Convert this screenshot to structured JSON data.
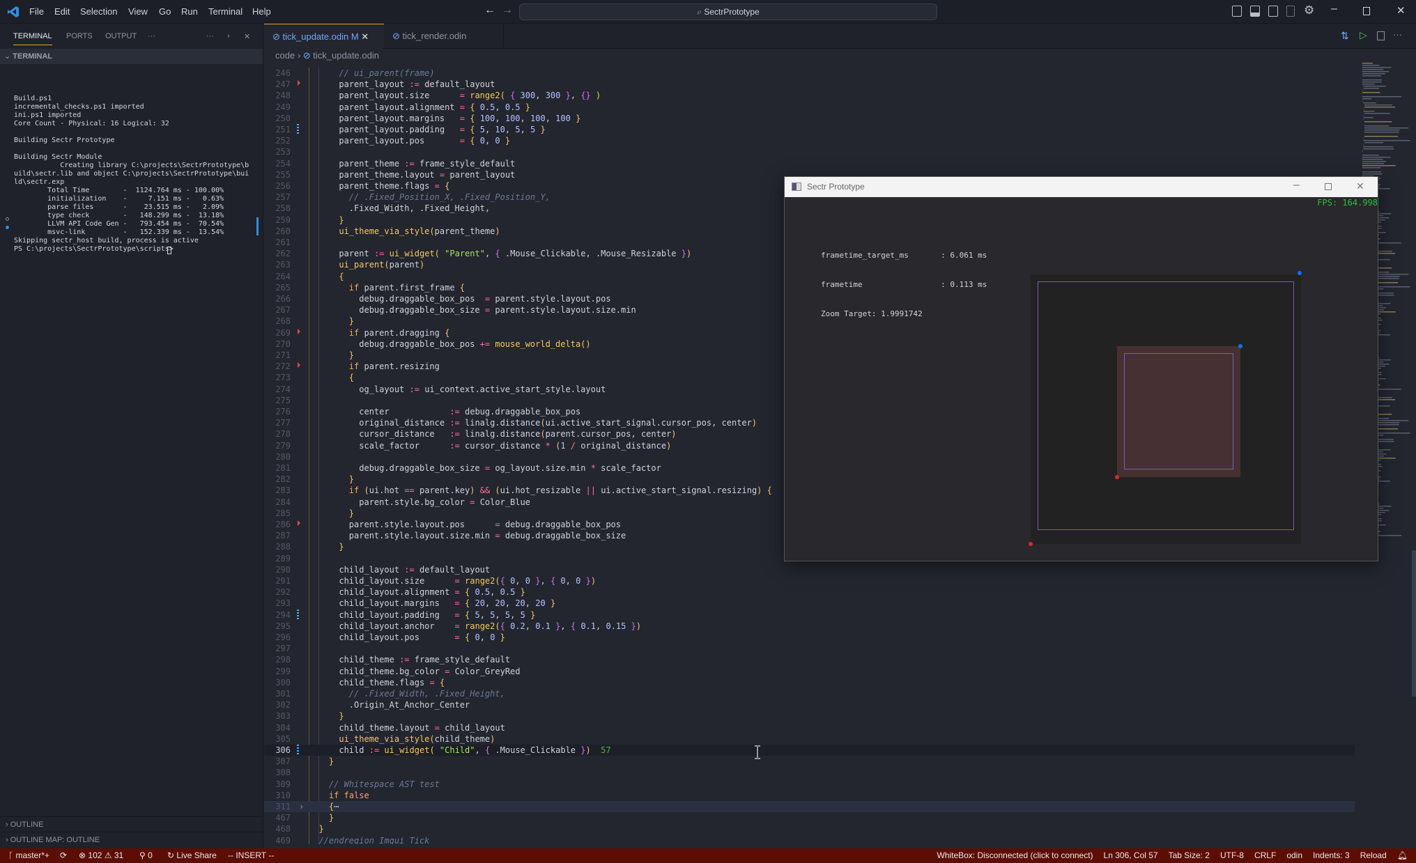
{
  "titlebar": {
    "menu": [
      "File",
      "Edit",
      "Selection",
      "View",
      "Go",
      "Run",
      "Terminal",
      "Help"
    ],
    "search_text": "SectrPrototype",
    "icons": [
      "toggle-primary-sidebar-icon",
      "toggle-panel-icon",
      "toggle-secondary-sidebar-icon",
      "customize-layout-icon",
      "settings-gear-icon"
    ],
    "window_controls": [
      "minimize-icon",
      "maximize-icon",
      "close-icon"
    ]
  },
  "panel": {
    "tabs": [
      {
        "label": "TERMINAL",
        "active": true
      },
      {
        "label": "PORTS"
      },
      {
        "label": "OUTPUT"
      }
    ],
    "more": "···",
    "section_title": "TERMINAL",
    "terminal_lines": [
      "Build.ps1",
      "incremental_checks.ps1 imported",
      "ini.ps1 imported",
      "Core Count - Physical: 16 Logical: 32",
      "",
      "Building Sectr Prototype",
      "",
      "Building Sectr Module",
      "           Creating library C:\\projects\\SectrPrototype\\b",
      "uild\\sectr.lib and object C:\\projects\\SectrPrototype\\bui",
      "ld\\sectr.exp",
      "        Total Time        -  1124.764 ms - 100.00%",
      "        initialization    -     7.151 ms -   0.63%",
      "        parse files       -    23.515 ms -   2.09%",
      "        type check        -   148.299 ms -  13.18%",
      "        LLVM API Code Gen -   793.454 ms -  70.54%",
      "        msvc-link         -   152.339 ms -  13.54%",
      "Skipping sectr_host build, process is active",
      "PS C:\\projects\\SectrPrototype\\scripts> "
    ],
    "outline": "OUTLINE",
    "outline_map": "OUTLINE MAP: OUTLINE"
  },
  "editor": {
    "tabs": [
      {
        "label": "tick_update.odin",
        "badge": "M",
        "active": true
      },
      {
        "label": "tick_render.odin"
      }
    ],
    "breadcrumb": [
      "code",
      "tick_update.odin"
    ],
    "current_line": 306,
    "folded_line": 311,
    "inlay_hint": "57",
    "lines": [
      [
        246,
        "      // ui_parent(frame)"
      ],
      [
        247,
        "      parent_layout := default_layout"
      ],
      [
        248,
        "      parent_layout.size      = range2( { 300, 300 }, {} )"
      ],
      [
        249,
        "      parent_layout.alignment = { 0.5, 0.5 }"
      ],
      [
        250,
        "      parent_layout.margins   = { 100, 100, 100, 100 }"
      ],
      [
        251,
        "      parent_layout.padding   = { 5, 10, 5, 5 }"
      ],
      [
        252,
        "      parent_layout.pos       = { 0, 0 }"
      ],
      [
        253,
        ""
      ],
      [
        254,
        "      parent_theme := frame_style_default"
      ],
      [
        255,
        "      parent_theme.layout = parent_layout"
      ],
      [
        256,
        "      parent_theme.flags = {"
      ],
      [
        257,
        "        // .Fixed_Position_X, .Fixed_Position_Y,"
      ],
      [
        258,
        "        .Fixed_Width, .Fixed_Height,"
      ],
      [
        259,
        "      }"
      ],
      [
        260,
        "      ui_theme_via_style(parent_theme)"
      ],
      [
        261,
        ""
      ],
      [
        262,
        "      parent := ui_widget( \"Parent\", { .Mouse_Clickable, .Mouse_Resizable })"
      ],
      [
        263,
        "      ui_parent(parent)"
      ],
      [
        264,
        "      {"
      ],
      [
        265,
        "        if parent.first_frame {"
      ],
      [
        266,
        "          debug.draggable_box_pos  = parent.style.layout.pos"
      ],
      [
        267,
        "          debug.draggable_box_size = parent.style.layout.size.min"
      ],
      [
        268,
        "        }"
      ],
      [
        269,
        "        if parent.dragging {"
      ],
      [
        270,
        "          debug.draggable_box_pos += mouse_world_delta()"
      ],
      [
        271,
        "        }"
      ],
      [
        272,
        "        if parent.resizing"
      ],
      [
        273,
        "        {"
      ],
      [
        274,
        "          og_layout := ui_context.active_start_style.layout"
      ],
      [
        275,
        ""
      ],
      [
        276,
        "          center            := debug.draggable_box_pos"
      ],
      [
        277,
        "          original_distance := linalg.distance(ui.active_start_signal.cursor_pos, center)"
      ],
      [
        278,
        "          cursor_distance   := linalg.distance(parent.cursor_pos, center)"
      ],
      [
        279,
        "          scale_factor      := cursor_distance * (1 / original_distance)"
      ],
      [
        280,
        ""
      ],
      [
        281,
        "          debug.draggable_box_size = og_layout.size.min * scale_factor"
      ],
      [
        282,
        "        }"
      ],
      [
        283,
        "        if (ui.hot == parent.key) && (ui.hot_resizable || ui.active_start_signal.resizing) {"
      ],
      [
        284,
        "          parent.style.bg_color = Color_Blue"
      ],
      [
        285,
        "        }"
      ],
      [
        286,
        "        parent.style.layout.pos      = debug.draggable_box_pos"
      ],
      [
        287,
        "        parent.style.layout.size.min = debug.draggable_box_size"
      ],
      [
        288,
        "      }"
      ],
      [
        289,
        ""
      ],
      [
        290,
        "      child_layout := default_layout"
      ],
      [
        291,
        "      child_layout.size      = range2({ 0, 0 }, { 0, 0 })"
      ],
      [
        292,
        "      child_layout.alignment = { 0.5, 0.5 }"
      ],
      [
        293,
        "      child_layout.margins   = { 20, 20, 20, 20 }"
      ],
      [
        294,
        "      child_layout.padding   = { 5, 5, 5, 5 }"
      ],
      [
        295,
        "      child_layout.anchor    = range2({ 0.2, 0.1 }, { 0.1, 0.15 })"
      ],
      [
        296,
        "      child_layout.pos       = { 0, 0 }"
      ],
      [
        297,
        ""
      ],
      [
        298,
        "      child_theme := frame_style_default"
      ],
      [
        299,
        "      child_theme.bg_color = Color_GreyRed"
      ],
      [
        300,
        "      child_theme.flags = {"
      ],
      [
        301,
        "        // .Fixed_Width, .Fixed_Height,"
      ],
      [
        302,
        "        .Origin_At_Anchor_Center"
      ],
      [
        303,
        "      }"
      ],
      [
        304,
        "      child_theme.layout = child_layout"
      ],
      [
        305,
        "      ui_theme_via_style(child_theme)"
      ],
      [
        306,
        "      child := ui_widget( \"Child\", { .Mouse_Clickable })"
      ],
      [
        307,
        "    }"
      ],
      [
        308,
        ""
      ],
      [
        309,
        "    // Whitespace AST test"
      ],
      [
        310,
        "    if false"
      ],
      [
        311,
        "    {⋯"
      ],
      [
        467,
        "    }"
      ],
      [
        468,
        "  }"
      ],
      [
        469,
        "  //endregion Imgui Tick"
      ],
      [
        470,
        ""
      ]
    ]
  },
  "app_window": {
    "title": "Sectr Prototype",
    "fps": "FPS: 164.998",
    "stats": [
      "frametime_target_ms       : 6.061 ms",
      "frametime                 : 0.113 ms",
      "Zoom Target: 1.9991742"
    ],
    "colors": {
      "bg": "#28282d",
      "parent_bg": "#222222",
      "child_bg": "#463033",
      "border": "#7b5ea7",
      "handle_max": "#0a74f0",
      "handle_min": "#e0242f",
      "fps": "#22c43a"
    }
  },
  "statusbar": {
    "branch": "master*+",
    "errors": "102",
    "warnings": "31",
    "ports": "0",
    "live_share": "Live Share",
    "mode": "-- INSERT --",
    "right": [
      "WhiteBox: Disconnected (click to connect)",
      "Ln 306, Col 57",
      "Tab Size: 2",
      "UTF-8",
      "CRLF",
      "odin",
      "Indents: 3",
      "Reload"
    ],
    "color": "#5c0e05"
  }
}
